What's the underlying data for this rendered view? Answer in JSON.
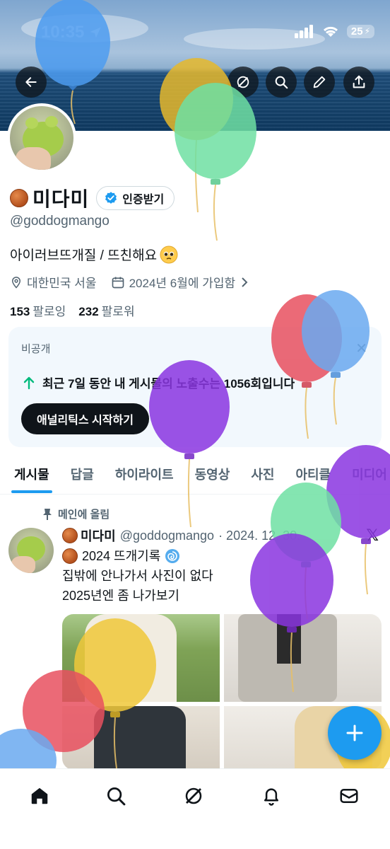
{
  "status": {
    "time": "10:35",
    "battery": "25"
  },
  "profile": {
    "name": "미다미",
    "verify_label": "인증받기",
    "handle": "@goddogmango",
    "bio": "아이러브뜨개질 / 뜨친해요",
    "location": "대한민국 서울",
    "joined": "2024년 6월에 가입함",
    "following_count": "153",
    "following_label": "팔로잉",
    "followers_count": "232",
    "followers_label": "팔로워"
  },
  "analytics_card": {
    "private_label": "비공개",
    "message": "최근 7일 동안 내 게시물의 노출수는 1056회입니다",
    "start_button": "애널리틱스 시작하기"
  },
  "tabs": [
    "게시물",
    "답글",
    "하이라이트",
    "동영상",
    "사진",
    "아티클",
    "미디어"
  ],
  "pinned_post": {
    "pinned_label": "메인에 올림",
    "author_name": "미다미",
    "author_handle": "@goddogmango",
    "date": "· 2024. 12. 30.",
    "line1": "2024 뜨개기록",
    "line2": "집밖에 안나가서 사진이 없다",
    "line3": "2025년엔 좀 나가보기"
  },
  "colors": {
    "accent": "#1d9bf0",
    "verified": "#1d9bf0",
    "text": "#0f1419",
    "muted": "#536471"
  },
  "icons": {
    "back": "arrow-left-icon",
    "grok": "grok-icon",
    "search": "search-icon",
    "edit": "pencil-icon",
    "share": "share-icon",
    "location": "location-pin-icon",
    "calendar": "calendar-icon",
    "arrow_up": "arrow-up-icon",
    "close": "close-icon",
    "pin": "pin-icon",
    "fab": "plus-icon",
    "nav": [
      "home-icon",
      "search-icon",
      "grok-icon",
      "bell-icon",
      "mail-icon"
    ]
  }
}
